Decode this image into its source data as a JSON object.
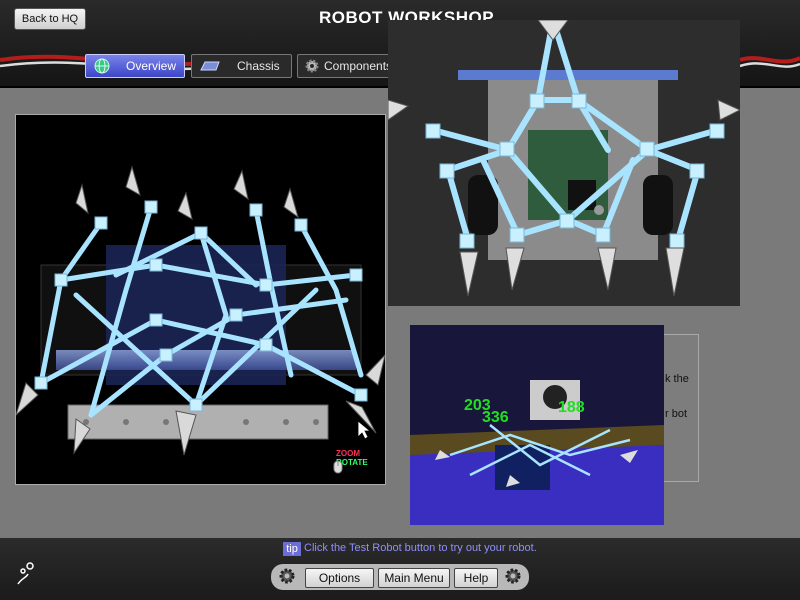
{
  "header": {
    "back_label": "Back to HQ",
    "title": "ROBOT WORKSHOP"
  },
  "tabs": [
    {
      "label": "Overview",
      "icon": "globe-icon",
      "active": true
    },
    {
      "label": "Chassis",
      "icon": "chassis-icon",
      "active": false
    },
    {
      "label": "Components",
      "icon": "gear-icon",
      "active": false
    }
  ],
  "viewer": {
    "zoom_label": "ZOOM",
    "rotate_label": "ROTATE"
  },
  "arena": {
    "numbers": [
      "203",
      "336",
      "188"
    ]
  },
  "info_fragments": [
    "k the",
    "r bot"
  ],
  "tip": {
    "badge": "tip",
    "text": "Click the Test Robot button to try out your robot."
  },
  "footer": {
    "options": "Options",
    "main_menu": "Main Menu",
    "help": "Help"
  },
  "colors": {
    "accent": "#3c46c8",
    "tip_text": "#8f8fff",
    "arena_numbers": "#1fe01f",
    "frame": "#a8e4ff"
  }
}
